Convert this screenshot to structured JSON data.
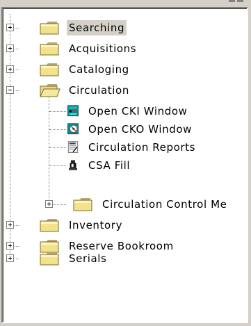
{
  "tree": {
    "selected": "Searching",
    "nodes": [
      {
        "label": "Searching",
        "expanded": false,
        "icon": "folder-icon"
      },
      {
        "label": "Acquisitions",
        "expanded": false,
        "icon": "folder-icon"
      },
      {
        "label": "Cataloging",
        "expanded": false,
        "icon": "folder-icon"
      },
      {
        "label": "Circulation",
        "expanded": true,
        "icon": "folder-open-icon",
        "children": [
          {
            "label": "Open CKI Window",
            "icon": "checkin-window-icon"
          },
          {
            "label": "Open CKO Window",
            "icon": "checkout-window-icon"
          },
          {
            "label": "Circulation Reports",
            "icon": "report-icon"
          },
          {
            "label": "CSA Fill",
            "icon": "csa-fill-icon"
          },
          {
            "label": "Circulation Control Me",
            "icon": "folder-icon",
            "expanded": false
          }
        ]
      },
      {
        "label": "Inventory",
        "expanded": false,
        "icon": "folder-icon"
      },
      {
        "label": "Reserve Bookroom",
        "expanded": false,
        "icon": "folder-icon"
      },
      {
        "label": "Serials",
        "expanded": false,
        "icon": "folder-icon"
      }
    ]
  }
}
